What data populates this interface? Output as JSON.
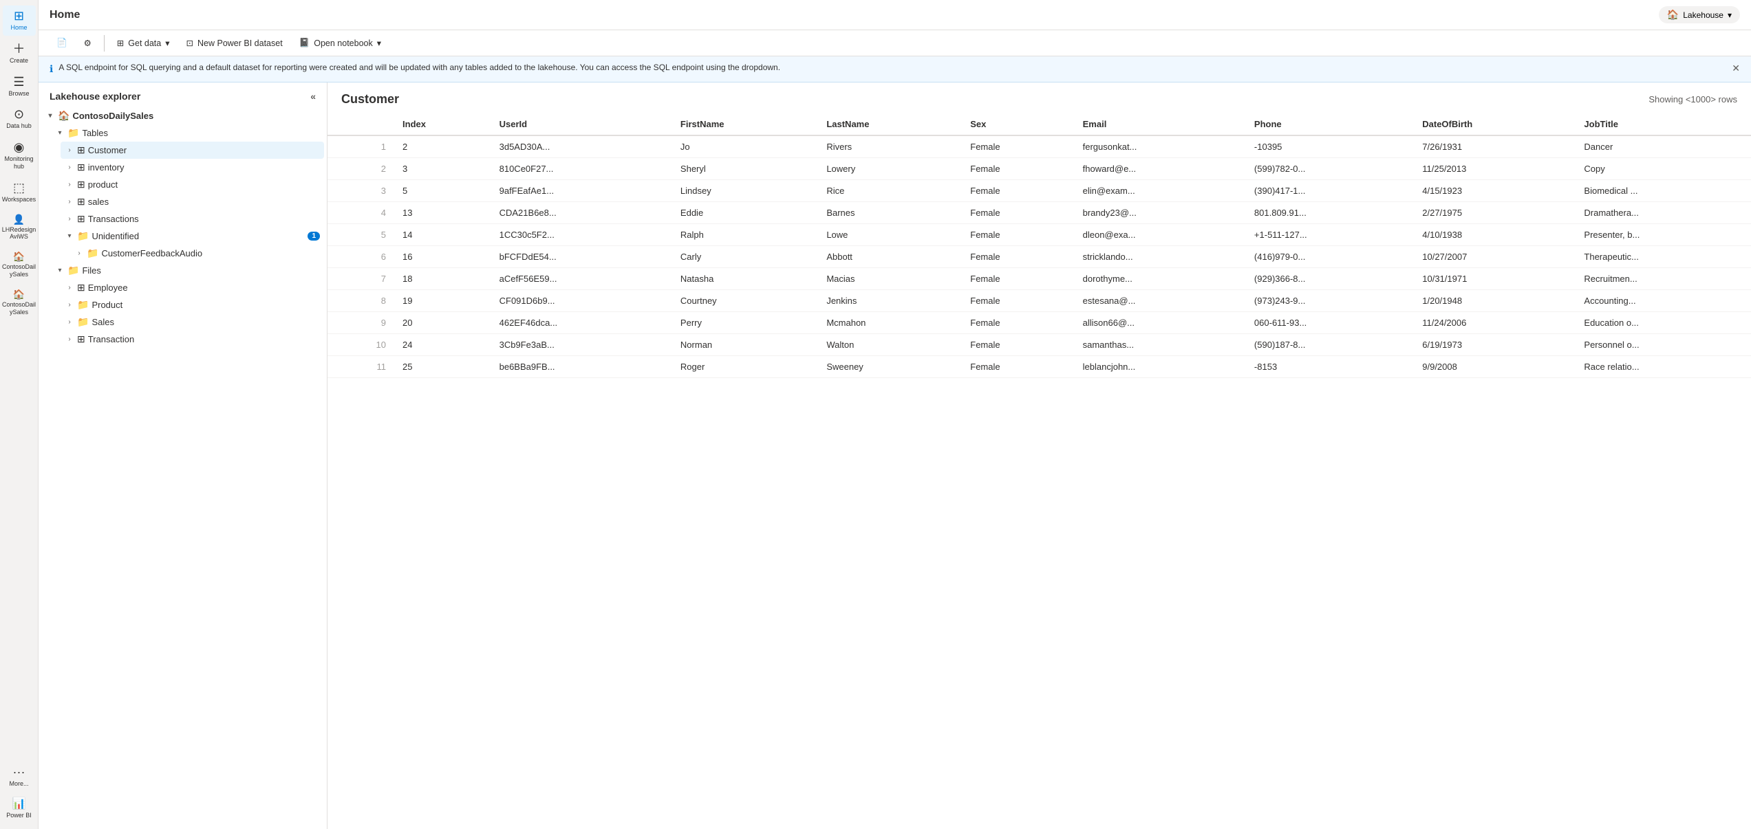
{
  "app": {
    "title": "Home",
    "lakehouse_label": "Lakehouse",
    "lakehouse_dropdown": "▾"
  },
  "toolbar": {
    "file_icon": "📄",
    "settings_icon": "⚙",
    "get_data_label": "Get data",
    "new_dataset_label": "New Power BI dataset",
    "open_notebook_label": "Open notebook",
    "cursor_pos": ""
  },
  "info_banner": {
    "text": "A SQL endpoint for SQL querying and a default dataset for reporting were created and will be updated with any tables added to the lakehouse. You can access the SQL endpoint using the dropdown."
  },
  "nav": {
    "items": [
      {
        "id": "home",
        "icon": "⊞",
        "label": "Home",
        "active": true
      },
      {
        "id": "create",
        "icon": "+",
        "label": "Create",
        "active": false
      },
      {
        "id": "browse",
        "icon": "☰",
        "label": "Browse",
        "active": false
      },
      {
        "id": "datahub",
        "icon": "⊙",
        "label": "Data hub",
        "active": false
      },
      {
        "id": "monitoring",
        "icon": "◎",
        "label": "Monitoring hub",
        "active": false
      },
      {
        "id": "workspaces",
        "icon": "⬚",
        "label": "Workspaces",
        "active": false
      },
      {
        "id": "lhredesign",
        "icon": "👤",
        "label": "LHRedesign AviWS",
        "active": false
      },
      {
        "id": "contosodaily1",
        "icon": "🏠",
        "label": "ContosoDail ySales",
        "active": false
      },
      {
        "id": "contosodaily2",
        "icon": "🏠",
        "label": "ContosoDail ySales",
        "active": false
      },
      {
        "id": "more",
        "icon": "···",
        "label": "More...",
        "active": false
      },
      {
        "id": "powerbi",
        "icon": "📊",
        "label": "Power BI",
        "active": false
      }
    ]
  },
  "explorer": {
    "title": "Lakehouse explorer",
    "root": "ContosoDailySales",
    "sections": {
      "tables": {
        "label": "Tables",
        "expanded": true,
        "items": [
          {
            "id": "customer",
            "label": "Customer",
            "selected": true,
            "type": "table"
          },
          {
            "id": "inventory",
            "label": "inventory",
            "selected": false,
            "type": "table"
          },
          {
            "id": "product",
            "label": "product",
            "selected": false,
            "type": "table"
          },
          {
            "id": "sales",
            "label": "sales",
            "selected": false,
            "type": "table"
          },
          {
            "id": "transactions",
            "label": "Transactions",
            "selected": false,
            "type": "table"
          }
        ],
        "unidentified": {
          "label": "Unidentified",
          "badge": "1",
          "items": [
            {
              "id": "customerfeedbackaudio",
              "label": "CustomerFeedbackAudio",
              "type": "folder"
            }
          ]
        }
      },
      "files": {
        "label": "Files",
        "expanded": true,
        "items": [
          {
            "id": "employee",
            "label": "Employee",
            "type": "file"
          },
          {
            "id": "product_file",
            "label": "Product",
            "type": "folder"
          },
          {
            "id": "sales_file",
            "label": "Sales",
            "type": "folder"
          },
          {
            "id": "transaction",
            "label": "Transaction",
            "type": "file"
          }
        ]
      }
    }
  },
  "data_view": {
    "title": "Customer",
    "row_count": "Showing <1000> rows",
    "columns": [
      "",
      "Index",
      "UserId",
      "FirstName",
      "LastName",
      "Sex",
      "Email",
      "Phone",
      "DateOfBirth",
      "JobTitle"
    ],
    "rows": [
      {
        "row": "1",
        "index": "2",
        "userid": "3d5AD30A...",
        "firstname": "Jo",
        "lastname": "Rivers",
        "sex": "Female",
        "email": "fergusonkat...",
        "phone": "-10395",
        "dob": "7/26/1931",
        "jobtitle": "Dancer"
      },
      {
        "row": "2",
        "index": "3",
        "userid": "810Ce0F27...",
        "firstname": "Sheryl",
        "lastname": "Lowery",
        "sex": "Female",
        "email": "fhoward@e...",
        "phone": "(599)782-0...",
        "dob": "11/25/2013",
        "jobtitle": "Copy"
      },
      {
        "row": "3",
        "index": "5",
        "userid": "9afFEafAe1...",
        "firstname": "Lindsey",
        "lastname": "Rice",
        "sex": "Female",
        "email": "elin@exam...",
        "phone": "(390)417-1...",
        "dob": "4/15/1923",
        "jobtitle": "Biomedical ..."
      },
      {
        "row": "4",
        "index": "13",
        "userid": "CDA21B6e8...",
        "firstname": "Eddie",
        "lastname": "Barnes",
        "sex": "Female",
        "email": "brandy23@...",
        "phone": "801.809.91...",
        "dob": "2/27/1975",
        "jobtitle": "Dramathera..."
      },
      {
        "row": "5",
        "index": "14",
        "userid": "1CC30c5F2...",
        "firstname": "Ralph",
        "lastname": "Lowe",
        "sex": "Female",
        "email": "dleon@exa...",
        "phone": "+1-511-127...",
        "dob": "4/10/1938",
        "jobtitle": "Presenter, b..."
      },
      {
        "row": "6",
        "index": "16",
        "userid": "bFCFDdE54...",
        "firstname": "Carly",
        "lastname": "Abbott",
        "sex": "Female",
        "email": "stricklando...",
        "phone": "(416)979-0...",
        "dob": "10/27/2007",
        "jobtitle": "Therapeutic..."
      },
      {
        "row": "7",
        "index": "18",
        "userid": "aCefF56E59...",
        "firstname": "Natasha",
        "lastname": "Macias",
        "sex": "Female",
        "email": "dorothyme...",
        "phone": "(929)366-8...",
        "dob": "10/31/1971",
        "jobtitle": "Recruitmen..."
      },
      {
        "row": "8",
        "index": "19",
        "userid": "CF091D6b9...",
        "firstname": "Courtney",
        "lastname": "Jenkins",
        "sex": "Female",
        "email": "estesana@...",
        "phone": "(973)243-9...",
        "dob": "1/20/1948",
        "jobtitle": "Accounting..."
      },
      {
        "row": "9",
        "index": "20",
        "userid": "462EF46dca...",
        "firstname": "Perry",
        "lastname": "Mcmahon",
        "sex": "Female",
        "email": "allison66@...",
        "phone": "060-611-93...",
        "dob": "11/24/2006",
        "jobtitle": "Education o..."
      },
      {
        "row": "10",
        "index": "24",
        "userid": "3Cb9Fe3aB...",
        "firstname": "Norman",
        "lastname": "Walton",
        "sex": "Female",
        "email": "samanthas...",
        "phone": "(590)187-8...",
        "dob": "6/19/1973",
        "jobtitle": "Personnel o..."
      },
      {
        "row": "11",
        "index": "25",
        "userid": "be6BBa9FB...",
        "firstname": "Roger",
        "lastname": "Sweeney",
        "sex": "Female",
        "email": "leblancjohn...",
        "phone": "-8153",
        "dob": "9/9/2008",
        "jobtitle": "Race relatio..."
      }
    ]
  },
  "colors": {
    "accent": "#0078d4",
    "bg_light": "#f3f2f1",
    "border": "#e1dfdd",
    "text_primary": "#323130",
    "text_secondary": "#605e5c"
  }
}
